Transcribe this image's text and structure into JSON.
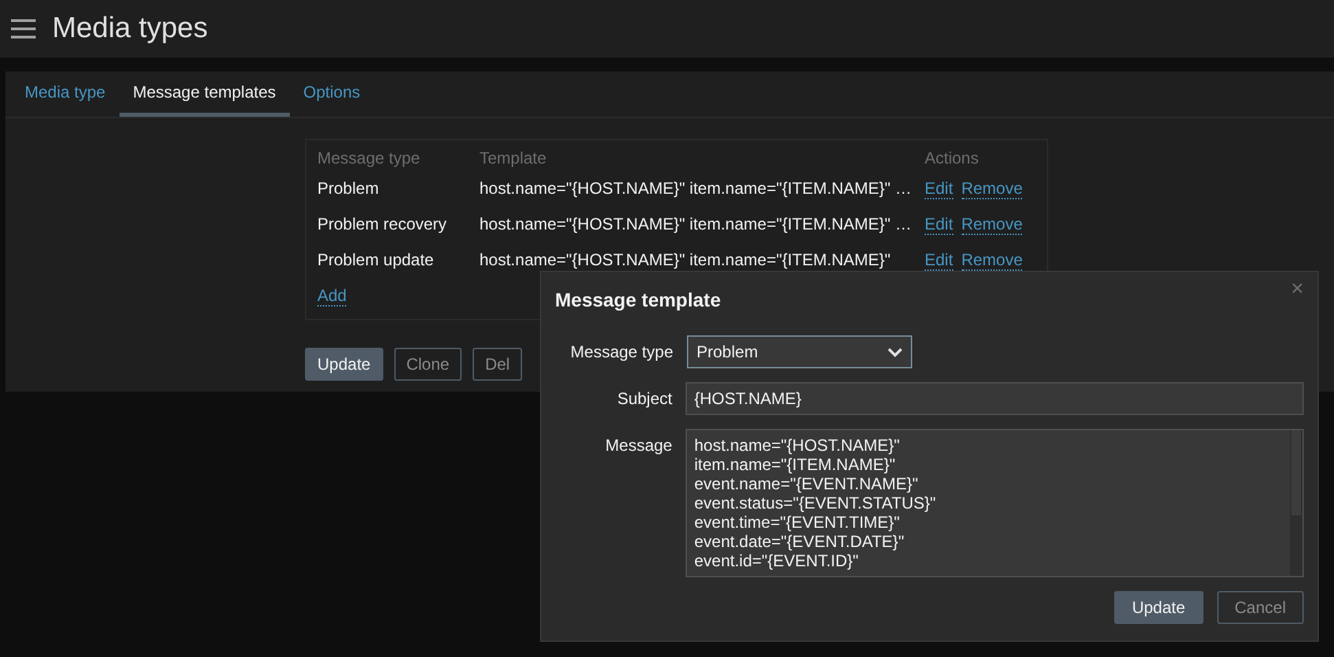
{
  "header": {
    "title": "Media types"
  },
  "tabs": [
    {
      "label": "Media type",
      "selected": false
    },
    {
      "label": "Message templates",
      "selected": true
    },
    {
      "label": "Options",
      "selected": false
    }
  ],
  "table": {
    "columns": [
      "Message type",
      "Template",
      "Actions"
    ],
    "rows": [
      {
        "message_type": "Problem",
        "template": "host.name=\"{HOST.NAME}\" item.name=\"{ITEM.NAME}\" …",
        "actions": [
          "Edit",
          "Remove"
        ]
      },
      {
        "message_type": "Problem recovery",
        "template": "host.name=\"{HOST.NAME}\" item.name=\"{ITEM.NAME}\" …",
        "actions": [
          "Edit",
          "Remove"
        ]
      },
      {
        "message_type": "Problem update",
        "template": "host.name=\"{HOST.NAME}\" item.name=\"{ITEM.NAME}\"",
        "actions": [
          "Edit",
          "Remove"
        ]
      }
    ],
    "add_link": "Add"
  },
  "form_buttons": [
    {
      "label": "Update",
      "kind": "primary"
    },
    {
      "label": "Clone",
      "kind": "secondary"
    },
    {
      "label": "Del",
      "kind": "secondary"
    }
  ],
  "dialog": {
    "title": "Message template",
    "close": "×",
    "message_type": {
      "label": "Message type",
      "value": "Problem"
    },
    "subject": {
      "label": "Subject",
      "value": "{HOST.NAME}"
    },
    "message": {
      "label": "Message",
      "value": "host.name=\"{HOST.NAME}\"\nitem.name=\"{ITEM.NAME}\"\nevent.name=\"{EVENT.NAME}\"\nevent.status=\"{EVENT.STATUS}\"\nevent.time=\"{EVENT.TIME}\"\nevent.date=\"{EVENT.DATE}\"\nevent.id=\"{EVENT.ID}\""
    },
    "buttons": [
      {
        "label": "Update",
        "kind": "primary"
      },
      {
        "label": "Cancel",
        "kind": "secondary"
      }
    ]
  }
}
